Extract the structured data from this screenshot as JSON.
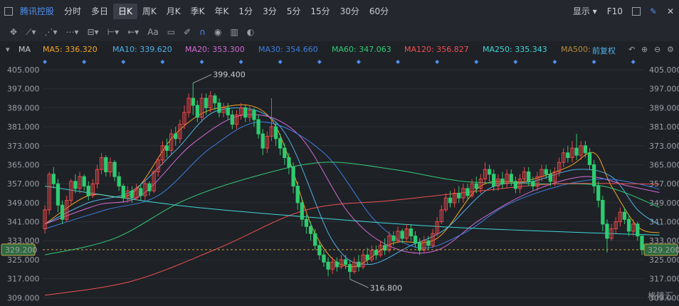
{
  "toolbar": {
    "title": "腾讯控股",
    "periods": [
      "分时",
      "多日",
      "日K",
      "周K",
      "月K",
      "季K",
      "年K",
      "1分",
      "3分",
      "5分",
      "15分",
      "30分",
      "60分"
    ],
    "active_period": "日K",
    "display_label": "显示",
    "f10_label": "F10"
  },
  "drawbar": {
    "text_tool": "Aa"
  },
  "ma_bar": {
    "title": "MA",
    "items": [
      {
        "label": "MA5: 336.320",
        "color": "#f5a623"
      },
      {
        "label": "MA10: 339.620",
        "color": "#4fb3e8"
      },
      {
        "label": "MA20: 353.300",
        "color": "#d36ad6"
      },
      {
        "label": "MA30: 354.660",
        "color": "#3d7fe0"
      },
      {
        "label": "MA60: 347.063",
        "color": "#33cc77"
      },
      {
        "label": "MA120: 356.827",
        "color": "#f05050"
      },
      {
        "label": "MA250: 335.343",
        "color": "#3fd8d8"
      },
      {
        "label": "MA500: ",
        "color": "#b38a3c"
      }
    ],
    "adjust_label": "前复权"
  },
  "watermark": "格隆汇",
  "colors": {
    "up": "#f04848",
    "down": "#2ecc71",
    "background": "#1e2126",
    "last_price_bg": "#2f6b3f"
  },
  "chart_data": {
    "type": "candlestick",
    "y_ticks": [
      "405.000",
      "397.000",
      "389.000",
      "381.000",
      "373.000",
      "365.000",
      "357.000",
      "349.000",
      "341.000",
      "333.000",
      "325.000",
      "317.000",
      "309.000"
    ],
    "ylim": [
      307,
      408
    ],
    "last_price": "329.200",
    "annotations": [
      {
        "label": "399.400",
        "value": 399.4,
        "bar_index": 34
      },
      {
        "label": "316.800",
        "value": 316.8,
        "bar_index": 70
      }
    ],
    "candles": [
      [
        338,
        346,
        336,
        348
      ],
      [
        346,
        361,
        344,
        362
      ],
      [
        361,
        357,
        355,
        364
      ],
      [
        357,
        348,
        345,
        359
      ],
      [
        348,
        342,
        340,
        350
      ],
      [
        342,
        350,
        341,
        352
      ],
      [
        350,
        358,
        348,
        359
      ],
      [
        358,
        355,
        353,
        361
      ],
      [
        355,
        360,
        353,
        362
      ],
      [
        360,
        356,
        354,
        361
      ],
      [
        356,
        352,
        350,
        358
      ],
      [
        352,
        357,
        351,
        359
      ],
      [
        357,
        363,
        355,
        365
      ],
      [
        363,
        368,
        361,
        370
      ],
      [
        368,
        362,
        360,
        369
      ],
      [
        362,
        366,
        360,
        368
      ],
      [
        366,
        360,
        358,
        367
      ],
      [
        360,
        356,
        354,
        362
      ],
      [
        356,
        351,
        349,
        357
      ],
      [
        351,
        354,
        349,
        356
      ],
      [
        354,
        351,
        349,
        356
      ],
      [
        351,
        355,
        350,
        357
      ],
      [
        355,
        352,
        350,
        357
      ],
      [
        352,
        357,
        350,
        359
      ],
      [
        357,
        354,
        352,
        358
      ],
      [
        354,
        362,
        353,
        363
      ],
      [
        362,
        367,
        360,
        368
      ],
      [
        367,
        373,
        365,
        375
      ],
      [
        373,
        371,
        368,
        376
      ],
      [
        371,
        378,
        369,
        380
      ],
      [
        378,
        376,
        373,
        381
      ],
      [
        376,
        382,
        374,
        384
      ],
      [
        382,
        387,
        380,
        390
      ],
      [
        387,
        393,
        385,
        395
      ],
      [
        393,
        390,
        386,
        399.4
      ],
      [
        390,
        385,
        383,
        392
      ],
      [
        385,
        393,
        383,
        395
      ],
      [
        393,
        389,
        386,
        395
      ],
      [
        389,
        394,
        387,
        396
      ],
      [
        394,
        391,
        388,
        395
      ],
      [
        391,
        387,
        385,
        393
      ],
      [
        387,
        389,
        385,
        391
      ],
      [
        389,
        386,
        384,
        391
      ],
      [
        386,
        382,
        380,
        388
      ],
      [
        382,
        386,
        380,
        388
      ],
      [
        386,
        389,
        384,
        391
      ],
      [
        389,
        385,
        383,
        390
      ],
      [
        385,
        388,
        383,
        390
      ],
      [
        388,
        384,
        381,
        389
      ],
      [
        384,
        378,
        376,
        386
      ],
      [
        378,
        372,
        369,
        380
      ],
      [
        372,
        377,
        370,
        379
      ],
      [
        377,
        381,
        375,
        393
      ],
      [
        381,
        376,
        373,
        383
      ],
      [
        376,
        372,
        369,
        378
      ],
      [
        372,
        368,
        365,
        374
      ],
      [
        368,
        364,
        361,
        370
      ],
      [
        364,
        356,
        353,
        366
      ],
      [
        356,
        349,
        346,
        358
      ],
      [
        349,
        342,
        339,
        351
      ],
      [
        342,
        339,
        336,
        344
      ],
      [
        339,
        336,
        333,
        341
      ],
      [
        336,
        331,
        329,
        338
      ],
      [
        331,
        327,
        325,
        333
      ],
      [
        327,
        324,
        322,
        329
      ],
      [
        324,
        321,
        318,
        326
      ],
      [
        321,
        324,
        319,
        326
      ],
      [
        324,
        322,
        320,
        326
      ],
      [
        322,
        325,
        321,
        327
      ],
      [
        325,
        323,
        321,
        327
      ],
      [
        323,
        320,
        316.8,
        325
      ],
      [
        320,
        324,
        319,
        326
      ],
      [
        324,
        322,
        320,
        327
      ],
      [
        322,
        327,
        321,
        329
      ],
      [
        327,
        325,
        323,
        330
      ],
      [
        325,
        329,
        324,
        331
      ],
      [
        329,
        327,
        325,
        331
      ],
      [
        327,
        331,
        326,
        333
      ],
      [
        331,
        329,
        327,
        334
      ],
      [
        329,
        335,
        328,
        337
      ],
      [
        335,
        333,
        331,
        337
      ],
      [
        333,
        337,
        332,
        339
      ],
      [
        337,
        334,
        332,
        338
      ],
      [
        334,
        338,
        333,
        340
      ],
      [
        338,
        335,
        333,
        340
      ],
      [
        335,
        332,
        330,
        337
      ],
      [
        332,
        329,
        327,
        334
      ],
      [
        329,
        333,
        328,
        335
      ],
      [
        333,
        331,
        329,
        335
      ],
      [
        331,
        336,
        330,
        338
      ],
      [
        336,
        341,
        335,
        343
      ],
      [
        341,
        346,
        340,
        348
      ],
      [
        346,
        351,
        345,
        353
      ],
      [
        351,
        349,
        347,
        354
      ],
      [
        349,
        353,
        347,
        355
      ],
      [
        353,
        351,
        349,
        356
      ],
      [
        351,
        355,
        349,
        357
      ],
      [
        355,
        352,
        350,
        357
      ],
      [
        352,
        357,
        351,
        359
      ],
      [
        357,
        355,
        353,
        360
      ],
      [
        355,
        359,
        353,
        361
      ],
      [
        359,
        363,
        357,
        366
      ],
      [
        363,
        361,
        358,
        365
      ],
      [
        361,
        356,
        354,
        363
      ],
      [
        356,
        359,
        354,
        361
      ],
      [
        359,
        357,
        355,
        362
      ],
      [
        357,
        361,
        355,
        363
      ],
      [
        361,
        358,
        356,
        363
      ],
      [
        358,
        355,
        353,
        360
      ],
      [
        355,
        359,
        353,
        361
      ],
      [
        359,
        362,
        357,
        364
      ],
      [
        362,
        358,
        356,
        364
      ],
      [
        358,
        356,
        354,
        360
      ],
      [
        356,
        360,
        354,
        362
      ],
      [
        360,
        363,
        358,
        365
      ],
      [
        363,
        361,
        359,
        365
      ],
      [
        361,
        358,
        356,
        363
      ],
      [
        358,
        362,
        356,
        364
      ],
      [
        362,
        366,
        360,
        368
      ],
      [
        366,
        370,
        364,
        372
      ],
      [
        370,
        368,
        366,
        373
      ],
      [
        368,
        372,
        366,
        375
      ],
      [
        372,
        369,
        367,
        378
      ],
      [
        369,
        373,
        367,
        375
      ],
      [
        373,
        370,
        368,
        375
      ],
      [
        370,
        365,
        363,
        372
      ],
      [
        365,
        356,
        353,
        367
      ],
      [
        356,
        350,
        347,
        358
      ],
      [
        350,
        340,
        337,
        352
      ],
      [
        340,
        334,
        328,
        342
      ],
      [
        334,
        338,
        333,
        340
      ],
      [
        338,
        341,
        336,
        343
      ],
      [
        341,
        345,
        339,
        347
      ],
      [
        345,
        342,
        340,
        347
      ],
      [
        342,
        337,
        335,
        344
      ],
      [
        337,
        340,
        335,
        342
      ],
      [
        340,
        335,
        333,
        341
      ],
      [
        335,
        329.2,
        327,
        331
      ]
    ],
    "moving_averages": [
      {
        "name": "MA5",
        "color": "#f5a623",
        "values": [
          [
            0,
            340
          ],
          [
            10,
            352
          ],
          [
            20,
            353
          ],
          [
            30,
            378
          ],
          [
            40,
            389
          ],
          [
            52,
            384
          ],
          [
            62,
            336
          ],
          [
            70,
            322
          ],
          [
            80,
            332
          ],
          [
            90,
            334
          ],
          [
            100,
            356
          ],
          [
            110,
            358
          ],
          [
            120,
            364
          ],
          [
            126,
            370
          ],
          [
            130,
            356
          ],
          [
            136,
            339
          ],
          [
            141,
            336.32
          ]
        ]
      },
      {
        "name": "MA10",
        "color": "#4fb3e8",
        "values": [
          [
            0,
            340
          ],
          [
            10,
            349
          ],
          [
            20,
            354
          ],
          [
            30,
            371
          ],
          [
            40,
            388
          ],
          [
            54,
            381
          ],
          [
            66,
            333
          ],
          [
            74,
            323
          ],
          [
            84,
            331
          ],
          [
            92,
            338
          ],
          [
            102,
            355
          ],
          [
            112,
            358
          ],
          [
            122,
            363
          ],
          [
            130,
            360
          ],
          [
            136,
            346
          ],
          [
            141,
            339.62
          ]
        ]
      },
      {
        "name": "MA20",
        "color": "#d36ad6",
        "values": [
          [
            0,
            340
          ],
          [
            12,
            348
          ],
          [
            22,
            352
          ],
          [
            34,
            374
          ],
          [
            46,
            386
          ],
          [
            58,
            378
          ],
          [
            70,
            344
          ],
          [
            80,
            330
          ],
          [
            90,
            329
          ],
          [
            100,
            342
          ],
          [
            112,
            354
          ],
          [
            124,
            360
          ],
          [
            134,
            356
          ],
          [
            141,
            353.3
          ]
        ]
      },
      {
        "name": "MA30",
        "color": "#3d7fe0",
        "values": [
          [
            0,
            338
          ],
          [
            14,
            346
          ],
          [
            26,
            352
          ],
          [
            38,
            372
          ],
          [
            50,
            383
          ],
          [
            64,
            370
          ],
          [
            76,
            341
          ],
          [
            86,
            330
          ],
          [
            96,
            336
          ],
          [
            106,
            348
          ],
          [
            118,
            356
          ],
          [
            128,
            359
          ],
          [
            136,
            357
          ],
          [
            141,
            354.66
          ]
        ]
      },
      {
        "name": "MA60",
        "color": "#33cc77",
        "values": [
          [
            0,
            327
          ],
          [
            16,
            334
          ],
          [
            32,
            350
          ],
          [
            48,
            360
          ],
          [
            64,
            366
          ],
          [
            80,
            363
          ],
          [
            96,
            358
          ],
          [
            112,
            357
          ],
          [
            128,
            356
          ],
          [
            141,
            347.063
          ]
        ]
      },
      {
        "name": "MA120",
        "color": "#f05050",
        "values": [
          [
            0,
            310
          ],
          [
            20,
            316
          ],
          [
            40,
            330
          ],
          [
            60,
            346
          ],
          [
            80,
            350
          ],
          [
            100,
            354
          ],
          [
            118,
            357
          ],
          [
            141,
            356.827
          ]
        ]
      },
      {
        "name": "MA250",
        "color": "#3fd8d8",
        "values": [
          [
            0,
            356
          ],
          [
            30,
            348
          ],
          [
            60,
            343
          ],
          [
            90,
            339
          ],
          [
            115,
            337
          ],
          [
            141,
            335.343
          ]
        ]
      }
    ]
  }
}
